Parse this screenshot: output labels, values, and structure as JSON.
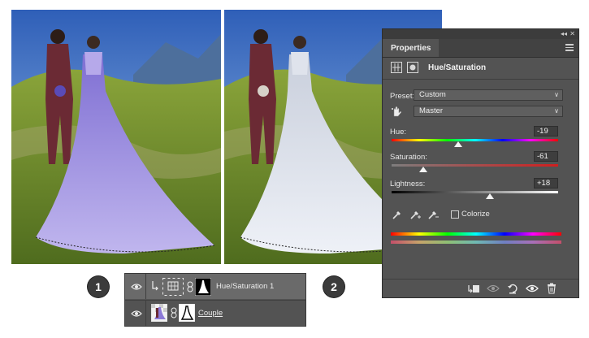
{
  "steps": {
    "first": "1",
    "second": "2"
  },
  "photos": {
    "before_label": "original-photo",
    "after_label": "adjusted-photo",
    "colors": {
      "sky": "#3a6fc9",
      "grass": "#6e8a2a",
      "suit": "#6b2a34",
      "gown_before": "#8d7ad8",
      "gown_after": "#d8dde8"
    }
  },
  "layers": {
    "items": [
      {
        "name": "Hue/Saturation 1",
        "type": "adjustment"
      },
      {
        "name": "Couple",
        "type": "pixel"
      }
    ]
  },
  "properties": {
    "tab_label": "Properties",
    "adjustment_title": "Hue/Saturation",
    "preset": {
      "label": "Preset:",
      "value": "Custom"
    },
    "channel": {
      "value": "Master"
    },
    "hue": {
      "label": "Hue:",
      "value": "-19",
      "min": -180,
      "max": 180
    },
    "saturation": {
      "label": "Saturation:",
      "value": "-61",
      "min": -100,
      "max": 100
    },
    "lightness": {
      "label": "Lightness:",
      "value": "+18",
      "min": -100,
      "max": 100
    },
    "colorize": {
      "label": "Colorize",
      "checked": false
    },
    "icons": {
      "hand_tool": "hand-icon",
      "eyedroppers": [
        "eyedropper-icon",
        "eyedropper-plus-icon",
        "eyedropper-minus-icon"
      ],
      "footer": [
        "clip-to-layer-icon",
        "view-previous-icon",
        "reset-icon",
        "visibility-icon",
        "delete-icon"
      ]
    }
  }
}
